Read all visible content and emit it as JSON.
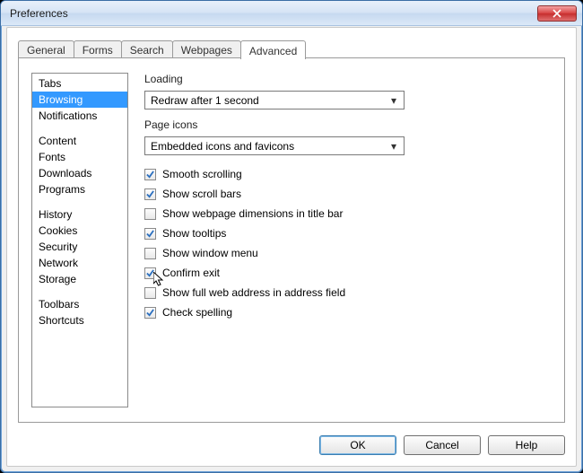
{
  "window": {
    "title": "Preferences"
  },
  "tabs": [
    "General",
    "Forms",
    "Search",
    "Webpages",
    "Advanced"
  ],
  "active_tab": 4,
  "sidebar": {
    "groups": [
      [
        "Tabs",
        "Browsing",
        "Notifications"
      ],
      [
        "Content",
        "Fonts",
        "Downloads",
        "Programs"
      ],
      [
        "History",
        "Cookies",
        "Security",
        "Network",
        "Storage"
      ],
      [
        "Toolbars",
        "Shortcuts"
      ]
    ],
    "selected": "Browsing"
  },
  "content": {
    "loading_label": "Loading",
    "loading_value": "Redraw after 1 second",
    "icons_label": "Page icons",
    "icons_value": "Embedded icons and favicons",
    "checks": [
      {
        "label": "Smooth scrolling",
        "checked": true
      },
      {
        "label": "Show scroll bars",
        "checked": true
      },
      {
        "label": "Show webpage dimensions in title bar",
        "checked": false
      },
      {
        "label": "Show tooltips",
        "checked": true
      },
      {
        "label": "Show window menu",
        "checked": false
      },
      {
        "label": "Confirm exit",
        "checked": true,
        "cursor": true
      },
      {
        "label": "Show full web address in address field",
        "checked": false
      },
      {
        "label": "Check spelling",
        "checked": true
      }
    ]
  },
  "buttons": {
    "ok": "OK",
    "cancel": "Cancel",
    "help": "Help"
  }
}
